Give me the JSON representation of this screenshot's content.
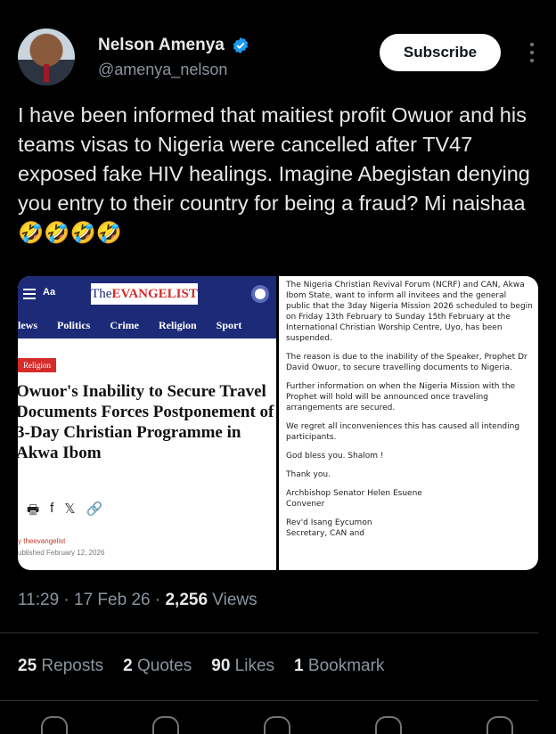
{
  "author": {
    "name": "Nelson Amenya",
    "handle": "@amenya_nelson",
    "subscribe_label": "Subscribe"
  },
  "tweet": {
    "text": "I have been informed that maitiest profit Owuor and his teams visas to Nigeria were cancelled after TV47 exposed fake HIV healings. Imagine Abegistan denying you entry to their country for being a fraud? Mi naishaa🤣🤣🤣🤣"
  },
  "media": {
    "left": {
      "aa": "Aa",
      "logo_the": "The",
      "logo_ev": "EVANGELIST",
      "nav": [
        "lews",
        "Politics",
        "Crime",
        "Religion",
        "Sport"
      ],
      "tag": "Religion",
      "headline": "Owuor's Inability to Secure Travel Documents Forces Postponement of 3-Day Christian Programme in Akwa Ibom",
      "byline": "y theevangelist",
      "date": "ublished February 12, 2026"
    },
    "right": {
      "paragraphs": [
        "The Nigeria Christian Revival Forum (NCRF) and CAN, Akwa Ibom State, want to inform all invitees and the general public that the 3day Nigeria Mission 2026 scheduled to begin on Friday 13th February to Sunday 15th February at the International Christian Worship Centre, Uyo, has been suspended.",
        "The reason is due to the inability of the Speaker, Prophet Dr David Owuor, to secure travelling documents to Nigeria.",
        "Further information on when the Nigeria Mission with the Prophet will hold will be announced once traveling arrangements are secured.",
        "We regret all inconveniences this has caused all intending participants.",
        "God bless you. Shalom !",
        "Thank you.",
        "Archbishop Senator Helen Esuene\nConvener",
        "Rev'd Isang Eycumon\nSecretary, CAN and"
      ]
    }
  },
  "meta": {
    "time": "11:29 · 17 Feb 26 · ",
    "views_count": "2,256",
    "views_label": " Views"
  },
  "stats": {
    "reposts_count": "25",
    "reposts_label": "Reposts",
    "quotes_count": "2",
    "quotes_label": "Quotes",
    "likes_count": "90",
    "likes_label": "Likes",
    "bookmarks_count": "1",
    "bookmarks_label": "Bookmark"
  },
  "colors": {
    "background": "#000000",
    "verified": "#1d9bf0",
    "evangelist_blue": "#1c2a78",
    "evangelist_red": "#d42b2b"
  }
}
